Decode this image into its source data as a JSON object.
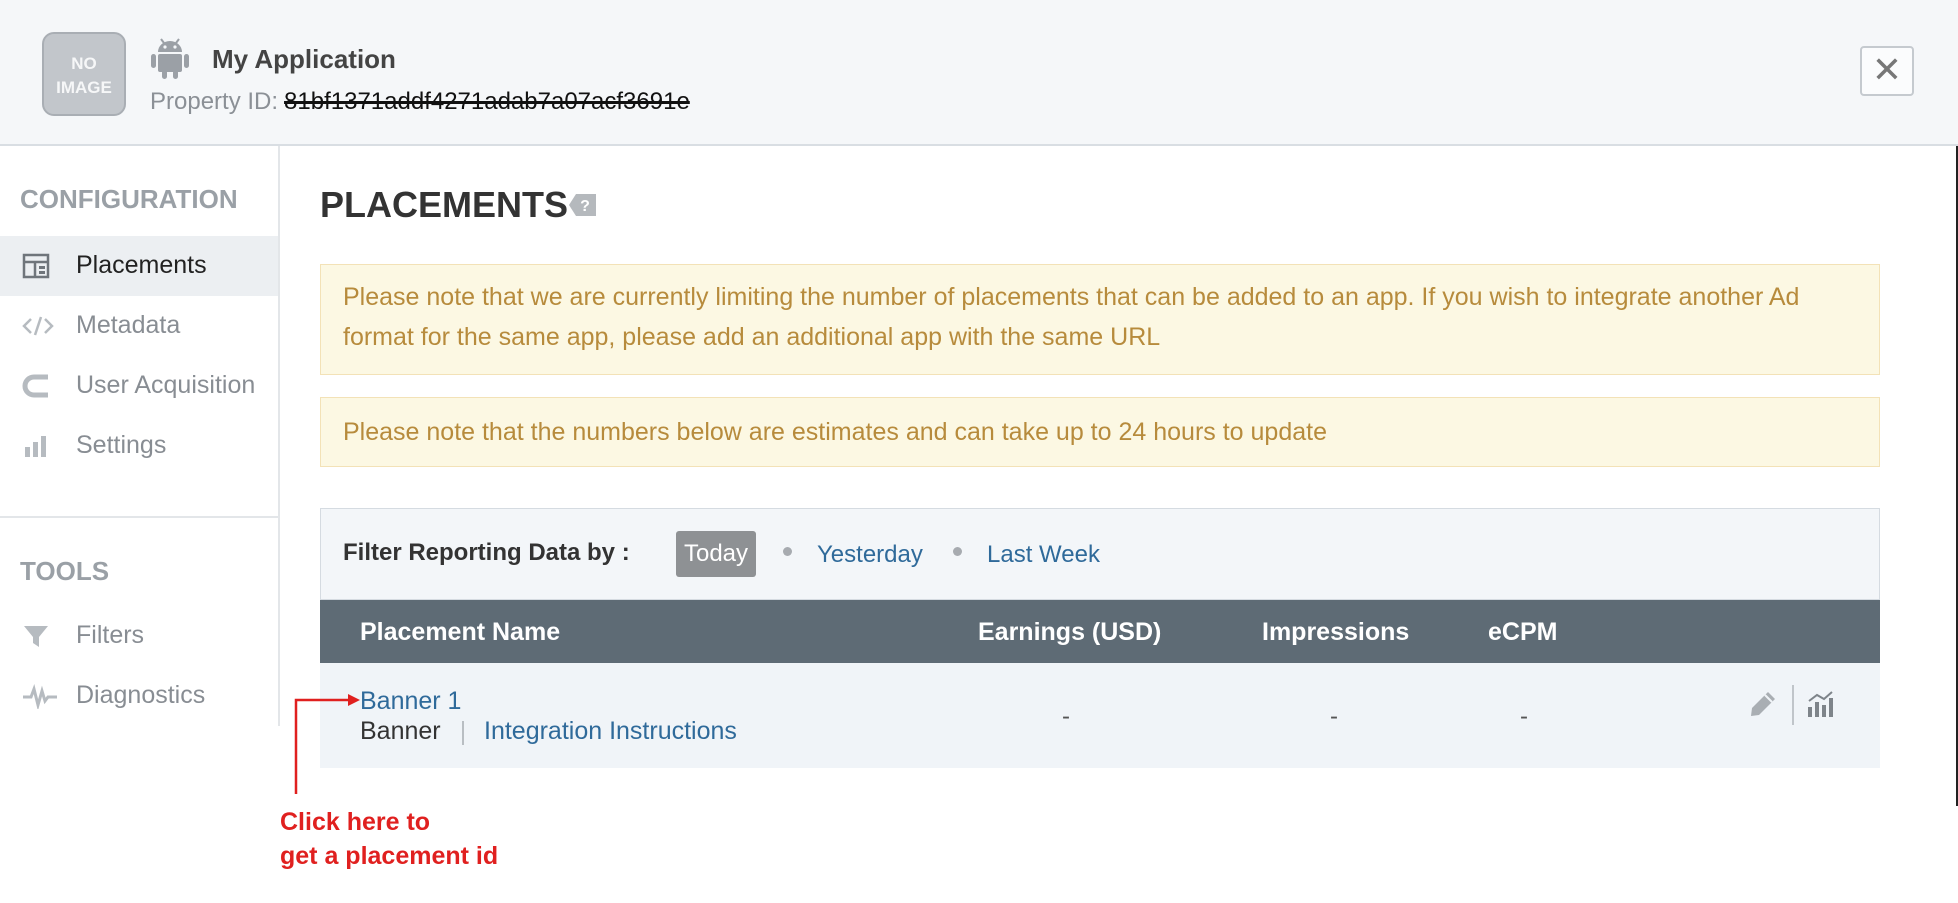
{
  "header": {
    "thumb_text": "NO IMAGE",
    "app_name": "My Application",
    "property_label": "Property ID:",
    "property_id": "81bf1371addf4271adab7a07acf3691e",
    "close_symbol": "✕"
  },
  "sidebar": {
    "config_title": "CONFIGURATION",
    "config_items": [
      {
        "label": "Placements",
        "icon": "placements-icon"
      },
      {
        "label": "Metadata",
        "icon": "code-icon"
      },
      {
        "label": "User Acquisition",
        "icon": "magnet-icon"
      },
      {
        "label": "Settings",
        "icon": "bar-chart-icon"
      }
    ],
    "tools_title": "TOOLS",
    "tools_items": [
      {
        "label": "Filters",
        "icon": "funnel-icon"
      },
      {
        "label": "Diagnostics",
        "icon": "pulse-icon"
      }
    ]
  },
  "main": {
    "title": "PLACEMENTS",
    "notice1": "Please note that we are currently limiting the number of placements that can be added to an app. If you wish to integrate another Ad format for the same app, please add an additional app with the same URL",
    "notice2": "Please note that the numbers below are estimates and can take up to 24 hours to update",
    "filter": {
      "label": "Filter Reporting Data by :",
      "options": [
        "Today",
        "Yesterday",
        "Last Week"
      ],
      "selected": "Today"
    },
    "table": {
      "columns": [
        "Placement Name",
        "Earnings (USD)",
        "Impressions",
        "eCPM"
      ],
      "rows": [
        {
          "name": "Banner 1",
          "type": "Banner",
          "link": "Integration Instructions",
          "earnings": "-",
          "impressions": "-",
          "ecpm": "-"
        }
      ]
    }
  },
  "annotation": {
    "line1": "Click here to",
    "line2": "get a placement id",
    "color": "#e0201f"
  },
  "colors": {
    "link": "#2f6a9a",
    "notice_text": "#b78b3c",
    "table_header": "#5e6b75"
  }
}
